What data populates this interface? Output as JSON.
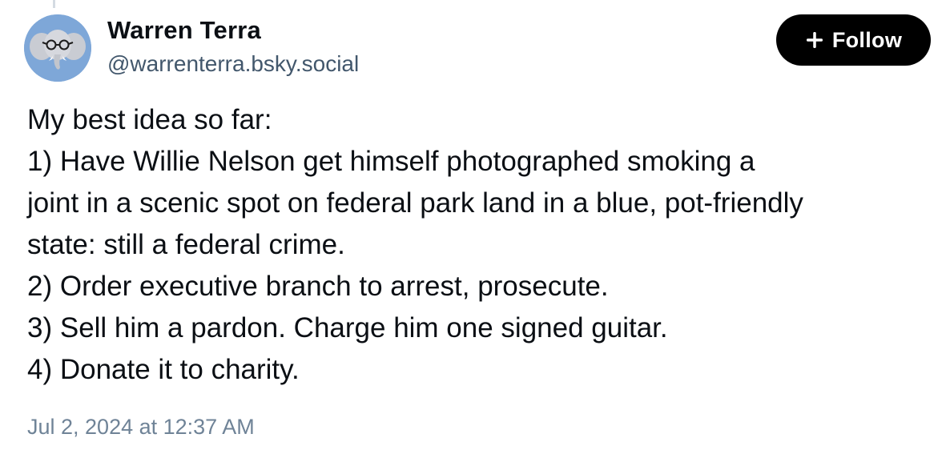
{
  "author": {
    "display_name": "Warren Terra",
    "handle": "@warrenterra.bsky.social",
    "avatar_icon": "elephant-with-glasses-icon"
  },
  "follow_button": {
    "label": "Follow",
    "icon": "plus-icon"
  },
  "post": {
    "lines": [
      "My best idea so far:",
      "1) Have Willie Nelson get himself photographed smoking a",
      "joint in a scenic spot on federal park land in a blue, pot-friendly",
      "state: still a federal crime.",
      "2) Order executive branch to arrest, prosecute.",
      "3) Sell him a pardon. Charge him one signed guitar.",
      "4) Donate it to charity."
    ],
    "timestamp": "Jul 2, 2024 at 12:37 AM"
  },
  "colors": {
    "avatar_background": "#7ea7d8",
    "button_background": "#000000",
    "handle_text": "#42576c",
    "timestamp_text": "#6f8397"
  }
}
